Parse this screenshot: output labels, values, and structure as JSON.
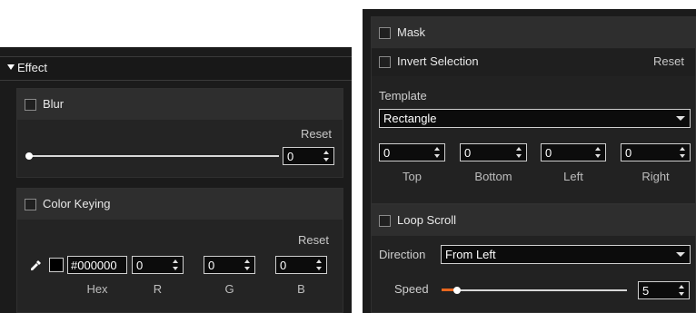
{
  "effect": {
    "header": "Effect",
    "blur": {
      "label": "Blur",
      "reset": "Reset",
      "value": "0",
      "slider_fraction": 0
    },
    "color_keying": {
      "label": "Color Keying",
      "reset": "Reset",
      "color": "#000000",
      "hex_value": "#000000",
      "r": "0",
      "g": "0",
      "b": "0",
      "labels": {
        "hex": "Hex",
        "r": "R",
        "g": "G",
        "b": "B"
      },
      "eyedropper_icon": "eyedropper-icon"
    }
  },
  "mask": {
    "label": "Mask",
    "invert_label": "Invert Selection",
    "reset": "Reset",
    "template_label": "Template",
    "template_value": "Rectangle",
    "top": "0",
    "bottom": "0",
    "left": "0",
    "right": "0",
    "labels": {
      "top": "Top",
      "bottom": "Bottom",
      "left": "Left",
      "right": "Right"
    }
  },
  "loop_scroll": {
    "label": "Loop Scroll",
    "direction_label": "Direction",
    "direction_value": "From Left",
    "speed_label": "Speed",
    "speed_value": "5",
    "accent_color": "#e8671e"
  }
}
